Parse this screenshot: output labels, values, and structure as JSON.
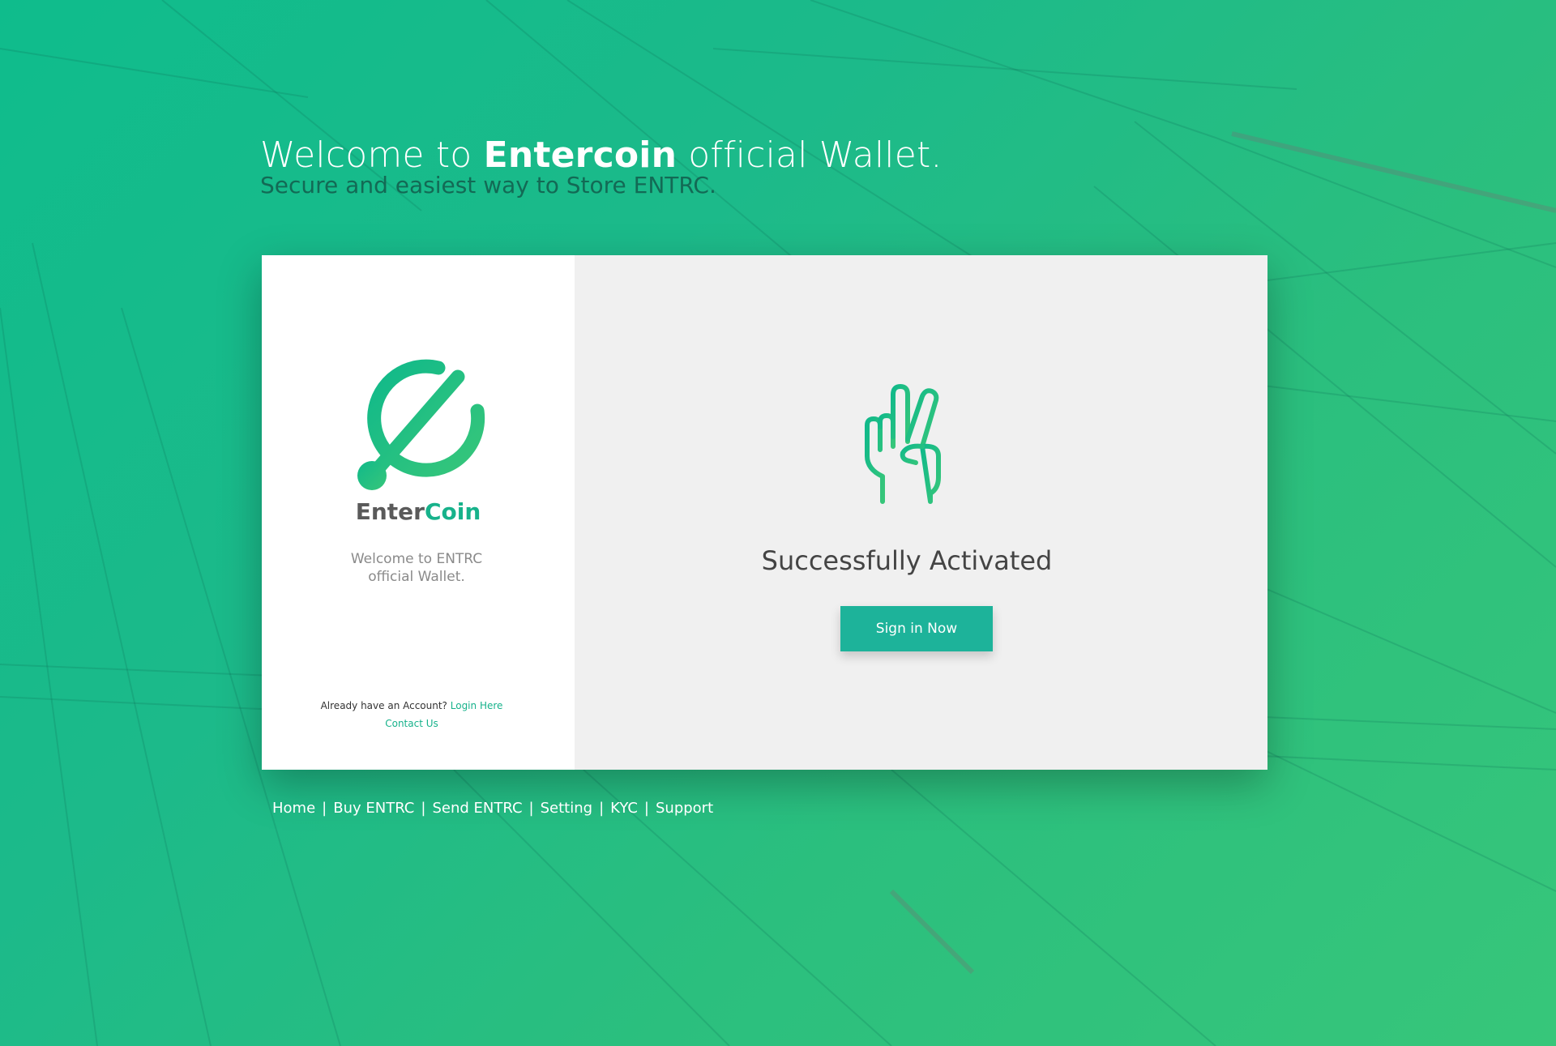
{
  "hero": {
    "title_prefix": "Welcome to ",
    "title_brand": "Entercoin",
    "title_suffix": " official Wallet.",
    "subtitle": "Secure and easiest way to Store ENTRC."
  },
  "sidebar": {
    "logo_icon": "entercoin-logo-icon",
    "logo_enter": "Enter",
    "logo_coin": "Coin",
    "welcome_line1": "Welcome to ENTRC",
    "welcome_line2": "official Wallet.",
    "account_prompt": "Already have an Account? ",
    "login_link": "Login Here",
    "contact_link": "Contact Us"
  },
  "main": {
    "status_icon": "victory-hand-icon",
    "status_text": "Successfully Activated",
    "signin_label": "Sign in Now"
  },
  "footer": {
    "nav": [
      "Home",
      "Buy ENTRC",
      "Send ENTRC",
      "Setting",
      "KYC",
      "Support"
    ],
    "separator": "|"
  },
  "colors": {
    "accent": "#17b28b",
    "button": "#1db39a",
    "background_start": "#0fbc8c",
    "background_end": "#37c67a"
  }
}
